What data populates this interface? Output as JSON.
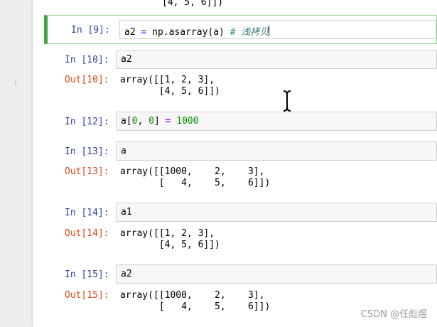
{
  "top_remnant": "[4, 5, 6]])",
  "selected": {
    "prompt": "In [9]:",
    "code_parts": [
      "a2",
      " = ",
      "np.asarray(a)",
      " # ",
      "浅拷贝"
    ]
  },
  "cells": [
    {
      "prompt": "In [10]:",
      "code": "a2",
      "out_prompt": "Out[10]:",
      "out_lines": [
        "array([[1, 2, 3],",
        "       [4, 5, 6]])"
      ]
    },
    {
      "prompt": "In [12]:",
      "code_parts": [
        "a[",
        "0",
        ", ",
        "0",
        "] ",
        "=",
        " ",
        "1000"
      ]
    },
    {
      "prompt": "In [13]:",
      "code": "a",
      "out_prompt": "Out[13]:",
      "out_lines": [
        "array([[1000,    2,    3],",
        "       [   4,    5,    6]])"
      ]
    },
    {
      "prompt": "In [14]:",
      "code": "a1",
      "out_prompt": "Out[14]:",
      "out_lines": [
        "array([[1, 2, 3],",
        "       [4, 5, 6]])"
      ]
    },
    {
      "prompt": "In [15]:",
      "code": "a2",
      "out_prompt": "Out[15]:",
      "out_lines": [
        "array([[1000,    2,    3],",
        "       [   4,    5,    6]])"
      ]
    }
  ],
  "watermark": "CSDN @任彪煜"
}
